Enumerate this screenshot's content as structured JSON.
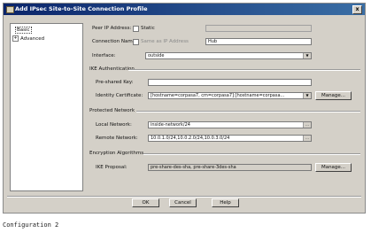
{
  "window": {
    "title": "Add IPsec Site-to-Site Connection Profile",
    "close_glyph": "x"
  },
  "tree": {
    "items": [
      {
        "label": "Basic"
      },
      {
        "label": "Advanced",
        "expander": "+"
      }
    ]
  },
  "form": {
    "peer_ip_label": "Peer IP Address:",
    "static_label": "Static",
    "peer_ip_value": "",
    "connection_name_label": "Connection Name:",
    "same_as_ip_label": "Same as IP Address",
    "connection_name_value": "Hub",
    "interface_label": "Interface:",
    "interface_value": "outside",
    "ike_auth_heading": "IKE Authentication",
    "preshared_label": "Pre-shared Key:",
    "preshared_value": "",
    "identity_cert_label": "Identity Certificate:",
    "identity_cert_value": "[hostname=corpasa7, cm=corpasa7]:[hostname=corpasa...",
    "manage_label": "Manage...",
    "protected_heading": "Protected Network",
    "local_network_label": "Local Network:",
    "local_network_value": "inside-network/24",
    "remote_network_label": "Remote Network:",
    "remote_network_value": "10.0.1.0/24,10.0.2.0/24,10.0.3.0/24",
    "encryption_heading": "Encryption Algorithms",
    "ike_proposal_label": "IKE Proposal:",
    "ike_proposal_value": "pre-share-des-sha, pre-share-3des-sha",
    "manage2_label": "Manage..."
  },
  "buttons": {
    "ok": "OK",
    "cancel": "Cancel",
    "help": "Help"
  },
  "caption": "Configuration 2"
}
